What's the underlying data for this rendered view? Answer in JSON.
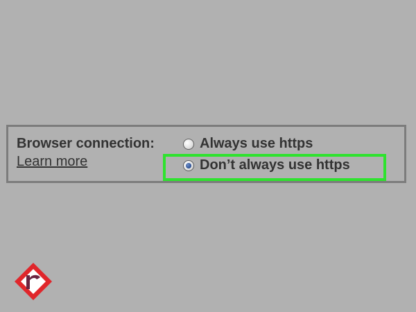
{
  "setting": {
    "label": "Browser connection:",
    "learn_more": "Learn more",
    "options": [
      {
        "label": "Always use https",
        "checked": false
      },
      {
        "label": "Don’t always use https",
        "checked": true
      }
    ]
  },
  "colors": {
    "background": "#b1b1b1",
    "panel_border": "#7c7c7c",
    "highlight": "#2ee32e",
    "logo_red": "#e0262b"
  },
  "logo": {
    "icon": "r-logo-icon"
  }
}
